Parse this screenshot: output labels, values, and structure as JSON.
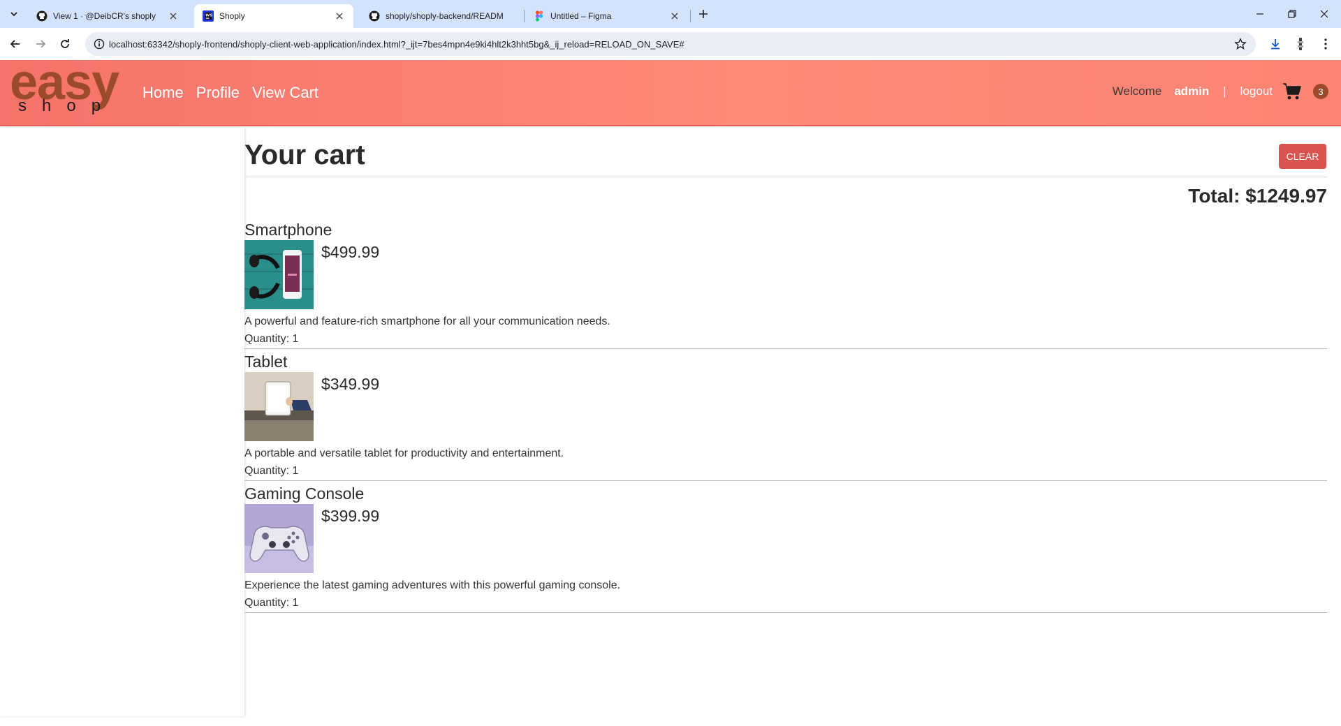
{
  "browser": {
    "tabs": [
      {
        "title": "View 1 · @DeibCR's shoply",
        "icon": "github-icon"
      },
      {
        "title": "Shoply",
        "icon": "webstorm-icon"
      },
      {
        "title": "shoply/shoply-backend/READM",
        "icon": "github-icon"
      },
      {
        "title": "Untitled – Figma",
        "icon": "figma-icon"
      }
    ],
    "url": "localhost:63342/shoply-frontend/shoply-client-web-application/index.html?_ijt=7bes4mpn4e9ki4hlt2k3hht5bg&_ij_reload=RELOAD_ON_SAVE#"
  },
  "header": {
    "logo_top": "easy",
    "logo_bottom": "shop",
    "nav": [
      "Home",
      "Profile",
      "View Cart"
    ],
    "welcome": "Welcome",
    "username": "admin",
    "separator": "|",
    "logout": "logout",
    "cart_count": "3"
  },
  "cart": {
    "title": "Your cart",
    "clear_label": "CLEAR",
    "total": "Total: $1249.97",
    "items": [
      {
        "name": "Smartphone",
        "price": "$499.99",
        "description": "A powerful and feature-rich smartphone for all your communication needs.",
        "quantity": "Quantity: 1"
      },
      {
        "name": "Tablet",
        "price": "$349.99",
        "description": "A portable and versatile tablet for productivity and entertainment.",
        "quantity": "Quantity: 1"
      },
      {
        "name": "Gaming Console",
        "price": "$399.99",
        "description": "Experience the latest gaming adventures with this powerful gaming console.",
        "quantity": "Quantity: 1"
      }
    ]
  },
  "colors": {
    "header_gradient_start": "#f4736a",
    "header_gradient_end": "#ff8a78",
    "brand_brown": "#9c4a2c",
    "clear_button": "#d9534f"
  }
}
